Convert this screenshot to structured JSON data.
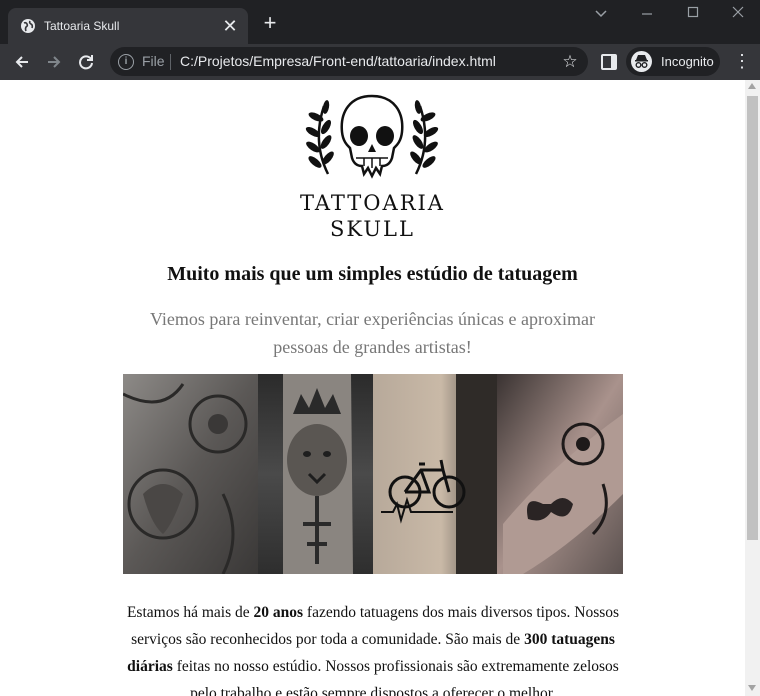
{
  "browser": {
    "tab_title": "Tattoaria Skull",
    "new_tab_glyph": "+",
    "close_glyph": "✕",
    "omnibox_scheme": "File",
    "url": "C:/Projetos/Empresa/Front-end/tattoaria/index.html",
    "profile_label": "Incognito",
    "icons": [
      "globe-icon",
      "close-icon",
      "plus-icon",
      "back-icon",
      "forward-icon",
      "reload-icon",
      "info-icon",
      "star-icon",
      "side-panel-icon",
      "incognito-icon",
      "menu-icon"
    ]
  },
  "page": {
    "brand_line1": "TATTOARIA",
    "brand_line2": "SKULL",
    "headline": "Muito mais que um simples estúdio de tatuagem",
    "subhead": "Viemos para reinventar, criar experiências únicas e aproximar pessoas de grandes artistas!",
    "body": {
      "p1": "Estamos há mais de ",
      "b1": "20 anos",
      "p2": " fazendo tatuagens dos mais diversos tipos. Nossos serviços são reconhecidos por toda a comunidade. São mais de ",
      "b2": "300 tatuagens diárias",
      "p3": " feitas no nosso estúdio. Nossos profissionais são extremamente zelosos pelo trabalho e estão sempre dispostos a oferecer o melhor."
    }
  },
  "colors": {
    "chrome_dark": "#202124",
    "chrome_tab": "#35363a",
    "chrome_text": "#e8eaed",
    "subhead_gray": "#777777"
  }
}
